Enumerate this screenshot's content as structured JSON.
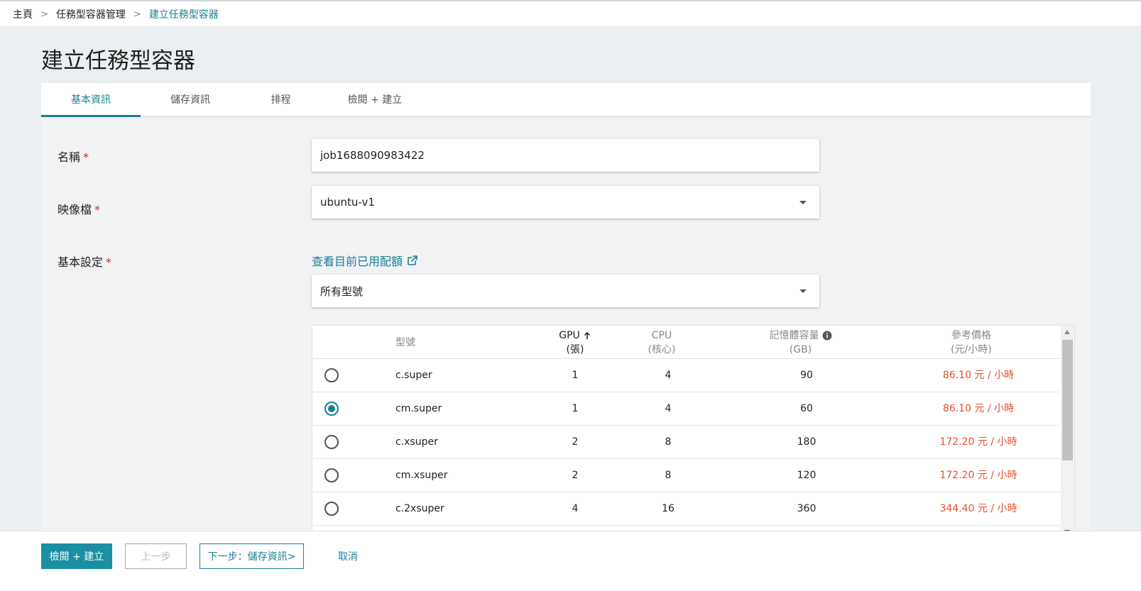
{
  "breadcrumb": {
    "home": "主頁",
    "section": "任務型容器管理",
    "current": "建立任務型容器",
    "separator": ">"
  },
  "page": {
    "title": "建立任務型容器"
  },
  "tabs": [
    {
      "label": "基本資訊",
      "active": true
    },
    {
      "label": "儲存資訊",
      "active": false
    },
    {
      "label": "排程",
      "active": false
    },
    {
      "label": "檢閱 + 建立",
      "active": false
    }
  ],
  "form": {
    "name": {
      "label": "名稱",
      "required_mark": "*",
      "value": "job1688090983422"
    },
    "image": {
      "label": "映像檔",
      "required_mark": "*",
      "value": "ubuntu-v1"
    },
    "basic": {
      "label": "基本設定",
      "required_mark": "*",
      "quota_link": "查看目前已用配額",
      "model_filter": "所有型號"
    }
  },
  "table": {
    "headers": {
      "model": "型號",
      "gpu": "GPU",
      "gpu_unit": "(張)",
      "cpu": "CPU",
      "cpu_unit": "(核心)",
      "memory": "記憶體容量",
      "memory_unit": "(GB)",
      "price": "參考價格",
      "price_unit": "(元/小時)"
    },
    "sort": {
      "column": "GPU",
      "direction": "ascending"
    },
    "rows": [
      {
        "model": "c.super",
        "gpu": "1",
        "cpu": "4",
        "memory": "90",
        "price": "86.10 元 / 小時",
        "selected": false
      },
      {
        "model": "cm.super",
        "gpu": "1",
        "cpu": "4",
        "memory": "60",
        "price": "86.10 元 / 小時",
        "selected": true
      },
      {
        "model": "c.xsuper",
        "gpu": "2",
        "cpu": "8",
        "memory": "180",
        "price": "172.20 元 / 小時",
        "selected": false
      },
      {
        "model": "cm.xsuper",
        "gpu": "2",
        "cpu": "8",
        "memory": "120",
        "price": "172.20 元 / 小時",
        "selected": false
      },
      {
        "model": "c.2xsuper",
        "gpu": "4",
        "cpu": "16",
        "memory": "360",
        "price": "344.40 元 / 小時",
        "selected": false
      }
    ]
  },
  "footer": {
    "review_create": "檢閱 + 建立",
    "previous": "上一步",
    "next": "下一步：儲存資訊>",
    "cancel": "取消"
  },
  "colors": {
    "accent": "#1a7f95",
    "primary_button": "#1b8fa3",
    "price": "#e4502e",
    "required": "#d62c1a",
    "page_background": "#eceff1"
  }
}
